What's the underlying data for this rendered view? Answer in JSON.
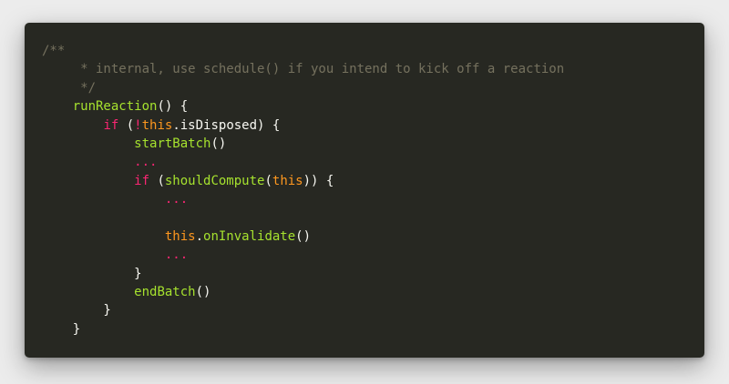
{
  "code": {
    "lines": [
      [
        {
          "t": "/**",
          "c": "comment"
        }
      ],
      [
        {
          "t": "     * internal, use schedule() if you intend to kick off a reaction",
          "c": "comment"
        }
      ],
      [
        {
          "t": "     */",
          "c": "comment"
        }
      ],
      [
        {
          "t": "    ",
          "c": "plain"
        },
        {
          "t": "runReaction",
          "c": "func"
        },
        {
          "t": "() {",
          "c": "plain"
        }
      ],
      [
        {
          "t": "        ",
          "c": "plain"
        },
        {
          "t": "if",
          "c": "keyword"
        },
        {
          "t": " (",
          "c": "plain"
        },
        {
          "t": "!",
          "c": "keyword"
        },
        {
          "t": "this",
          "c": "this"
        },
        {
          "t": ".isDisposed) {",
          "c": "plain"
        }
      ],
      [
        {
          "t": "            ",
          "c": "plain"
        },
        {
          "t": "startBatch",
          "c": "func"
        },
        {
          "t": "()",
          "c": "plain"
        }
      ],
      [
        {
          "t": "            ",
          "c": "plain"
        },
        {
          "t": "...",
          "c": "ellipsis"
        }
      ],
      [
        {
          "t": "            ",
          "c": "plain"
        },
        {
          "t": "if",
          "c": "keyword"
        },
        {
          "t": " (",
          "c": "plain"
        },
        {
          "t": "shouldCompute",
          "c": "func"
        },
        {
          "t": "(",
          "c": "plain"
        },
        {
          "t": "this",
          "c": "this"
        },
        {
          "t": ")) {",
          "c": "plain"
        }
      ],
      [
        {
          "t": "                ",
          "c": "plain"
        },
        {
          "t": "...",
          "c": "ellipsis"
        }
      ],
      [
        {
          "t": "",
          "c": "plain"
        }
      ],
      [
        {
          "t": "                ",
          "c": "plain"
        },
        {
          "t": "this",
          "c": "this"
        },
        {
          "t": ".",
          "c": "plain"
        },
        {
          "t": "onInvalidate",
          "c": "func"
        },
        {
          "t": "()",
          "c": "plain"
        }
      ],
      [
        {
          "t": "                ",
          "c": "plain"
        },
        {
          "t": "...",
          "c": "ellipsis"
        }
      ],
      [
        {
          "t": "            }",
          "c": "plain"
        }
      ],
      [
        {
          "t": "            ",
          "c": "plain"
        },
        {
          "t": "endBatch",
          "c": "func"
        },
        {
          "t": "()",
          "c": "plain"
        }
      ],
      [
        {
          "t": "        }",
          "c": "plain"
        }
      ],
      [
        {
          "t": "    }",
          "c": "plain"
        }
      ]
    ]
  },
  "colors": {
    "background": "#272822",
    "comment": "#75715e",
    "function": "#a6e22e",
    "keyword": "#f92672",
    "this": "#fd971f",
    "plain": "#f8f8f2"
  }
}
